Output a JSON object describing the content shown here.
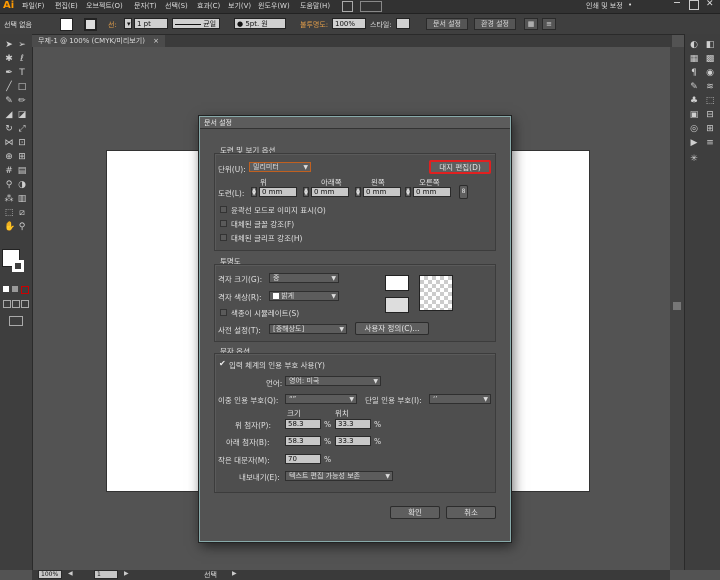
{
  "menubar": {
    "logo": "Ai",
    "items": [
      "파일(F)",
      "편집(E)",
      "오브젝트(O)",
      "문자(T)",
      "선택(S)",
      "효과(C)",
      "보기(V)",
      "윈도우(W)",
      "도움말(H)"
    ],
    "right_items": [
      "인쇄 및 보정",
      "•"
    ]
  },
  "controlbar": {
    "selection": "선택 없음",
    "stroke_label": "선:",
    "stroke_value": "1 pt",
    "uniform_label": "균일",
    "brush_value": "5pt. 원",
    "opacity_label": "불투명도:",
    "opacity_value": "100%",
    "style_label": "스타일:",
    "doc_setup_btn": "문서 설정",
    "prefs_btn": "환경 설정"
  },
  "doc_tab": {
    "title": "무제-1 @ 100% (CMYK/미리보기)",
    "close": "×"
  },
  "dialog": {
    "title": "문서 설정",
    "bleed_section": {
      "title": "도련 및 보기 옵션",
      "units_label": "단위(U):",
      "units_value": "밀리미터",
      "edit_artboards_btn": "대지 편집(D)",
      "col_top": "위",
      "col_bottom": "아래쪽",
      "col_left": "왼쪽",
      "col_right": "오른쪽",
      "bleed_label": "도련(L):",
      "top": "0 mm",
      "bottom": "0 mm",
      "left": "0 mm",
      "right": "0 mm",
      "chk_outline_images": "윤곽선 모드로 이미지 표시(O)",
      "chk_sub_fonts": "대체된 글꼴 강조(F)",
      "chk_sub_glyphs": "대체된 글리프 강조(H)"
    },
    "transparency_section": {
      "title": "투명도",
      "grid_size_label": "격자 크기(G):",
      "grid_size_value": "중",
      "grid_colors_label": "격자 색상(R):",
      "grid_colors_value": "밝게",
      "chk_simulate_paper": "색종이 시뮬레이트(S)",
      "preset_label": "사전 설정(T):",
      "preset_value": "[중해상도]",
      "custom_btn": "사용자 정의(C)..."
    },
    "type_section": {
      "title": "문자 옵션",
      "chk_typographer_quotes": "입력 체계의 인용 부호 사용(Y)",
      "language_label": "언어:",
      "language_value": "영어: 미국",
      "double_quotes_label": "이중 인용 부호(Q):",
      "double_quotes_value": "“”",
      "single_quotes_label": "단일 인용 부호(I):",
      "single_quotes_value": "‘’",
      "col_size": "크기",
      "col_position": "위치",
      "superscript_label": "위 첨자(P):",
      "superscript_size": "58.3",
      "superscript_pos": "33.3",
      "subscript_label": "아래 첨자(B):",
      "subscript_size": "58.3",
      "subscript_pos": "33.3",
      "smallcaps_label": "작은 대문자(M):",
      "smallcaps_value": "70",
      "percent": "%",
      "export_label": "내보내기(E):",
      "export_value": "텍스트 편집 가능성 보존"
    },
    "ok_btn": "확인",
    "cancel_btn": "취소"
  },
  "statusbar": {
    "zoom": "100%",
    "page": "1",
    "mode": "선택"
  },
  "colors": {
    "accent_orange": "#ff9a00",
    "highlight_red": "#e02020"
  }
}
